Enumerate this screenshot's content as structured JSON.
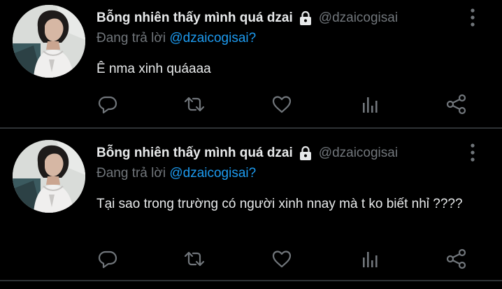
{
  "tweets": [
    {
      "author": {
        "display_name": "Bỗng nhiên thấy mình quá dzai",
        "handle": "@dzaicogisai"
      },
      "reply_prefix": "Đang trả lời ",
      "reply_to": "@dzaicogisai?",
      "text": "Ê nma xinh quáaaa"
    },
    {
      "author": {
        "display_name": "Bỗng nhiên thấy mình quá dzai",
        "handle": "@dzaicogisai"
      },
      "reply_prefix": "Đang trả lời ",
      "reply_to": "@dzaicogisai?",
      "text": "Tại sao trong trường có người xinh nnay mà t ko biết nhỉ ????"
    }
  ],
  "icons": {
    "lock": "lock-icon",
    "more": "more-vertical-icon",
    "reply": "reply-icon",
    "retweet": "retweet-icon",
    "like": "heart-icon",
    "stats": "stats-icon",
    "share": "share-icon"
  },
  "colors": {
    "background": "#000000",
    "text_primary": "#e7e9ea",
    "text_secondary": "#71767b",
    "mention": "#1d9bf0",
    "divider": "#2f3336"
  }
}
